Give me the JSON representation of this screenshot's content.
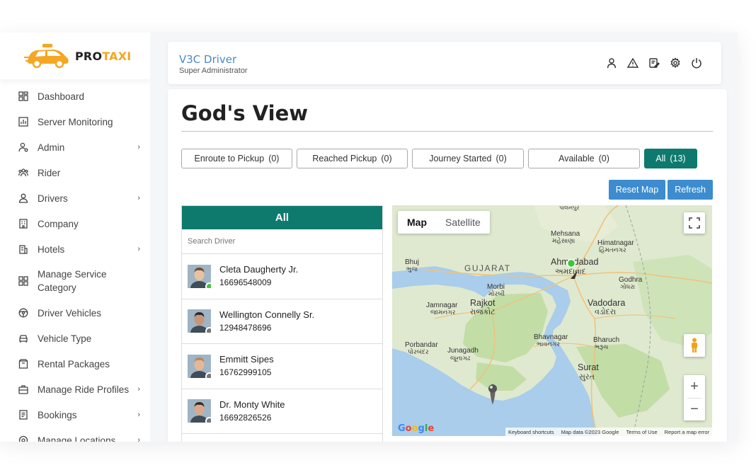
{
  "brand": {
    "pro": "PRO",
    "taxi": "TAXI"
  },
  "sidebar": {
    "items": [
      {
        "label": "Dashboard",
        "icon": "dashboard-icon",
        "has_sub": false
      },
      {
        "label": "Server Monitoring",
        "icon": "chart-icon",
        "has_sub": false
      },
      {
        "label": "Admin",
        "icon": "user-gear-icon",
        "has_sub": true
      },
      {
        "label": "Rider",
        "icon": "users-icon",
        "has_sub": false
      },
      {
        "label": "Drivers",
        "icon": "driver-icon",
        "has_sub": true
      },
      {
        "label": "Company",
        "icon": "building-icon",
        "has_sub": false
      },
      {
        "label": "Hotels",
        "icon": "hotel-icon",
        "has_sub": true
      },
      {
        "label": "Manage Service Category",
        "icon": "grid-icon",
        "has_sub": false
      },
      {
        "label": "Driver Vehicles",
        "icon": "steering-wheel-icon",
        "has_sub": false
      },
      {
        "label": "Vehicle Type",
        "icon": "car-icon",
        "has_sub": false
      },
      {
        "label": "Rental Packages",
        "icon": "package-icon",
        "has_sub": false
      },
      {
        "label": "Manage Ride Profiles",
        "icon": "briefcase-icon",
        "has_sub": true
      },
      {
        "label": "Bookings",
        "icon": "booking-icon",
        "has_sub": true
      },
      {
        "label": "Manage Locations",
        "icon": "location-icon",
        "has_sub": true
      }
    ]
  },
  "header": {
    "title": "V3C Driver",
    "subtitle": "Super Administrator"
  },
  "page": {
    "title": "God's View"
  },
  "filters": [
    {
      "label": "Enroute to Pickup",
      "count": "(0)",
      "active": false
    },
    {
      "label": "Reached Pickup",
      "count": "(0)",
      "active": false
    },
    {
      "label": "Journey Started",
      "count": "(0)",
      "active": false
    },
    {
      "label": "Available",
      "count": "(0)",
      "active": false
    },
    {
      "label": "All",
      "count": "(13)",
      "active": true
    }
  ],
  "actions": {
    "reset": "Reset Map",
    "refresh": "Refresh"
  },
  "driver_list": {
    "heading": "All",
    "search_placeholder": "Search Driver",
    "drivers": [
      {
        "name": "Cleta Daugherty Jr.",
        "phone": "16696548009",
        "status_color": "#3fc43f"
      },
      {
        "name": "Wellington Connelly Sr.",
        "phone": "12948478696",
        "status_color": "#777777"
      },
      {
        "name": "Emmitt Sipes",
        "phone": "16762999105",
        "status_color": "#777777"
      },
      {
        "name": "Dr. Monty White",
        "phone": "16692826526",
        "status_color": "#777777"
      }
    ]
  },
  "map": {
    "type_map": "Map",
    "type_satellite": "Satellite",
    "labels": {
      "gujarat": "GUJARAT",
      "ahmedabad": "Ahmedabad",
      "ahmedabad_local": "અમદાવાદ",
      "vadodara": "Vadodara",
      "vadodara_local": "વડોદરા",
      "rajkot": "Rajkot",
      "rajkot_local": "રાજકોટ",
      "bhavnagar": "Bhavnagar",
      "bhavnagar_local": "ભાવનગર",
      "surat": "Surat",
      "surat_local": "સુરત",
      "jamnagar": "Jamnagar",
      "jamnagar_local": "જામનગર",
      "junagadh": "Junagadh",
      "junagadh_local": "જૂનાગઢ",
      "porbandar": "Porbandar",
      "porbandar_local": "પોરબંદર",
      "bhuj": "Bhuj",
      "bhuj_local": "ભુજ",
      "morbi": "Morbi",
      "morbi_local": "મોરબી",
      "mehsana": "Mehsana",
      "mehsana_local": "મહેસાણા",
      "himatnagar": "Himatnagar",
      "himatnagar_local": "હિંમતનગર",
      "bharuch": "Bharuch",
      "bharuch_local": "ભરૂચ",
      "godhra": "Godhra",
      "godhra_local": "ગોધરા",
      "palanpur_local": "પાલનપુર"
    },
    "google": "Google",
    "footer": {
      "shortcuts": "Keyboard shortcuts",
      "data": "Map data ©2023 Google",
      "terms": "Terms of Use",
      "report": "Report a map error"
    },
    "colors": {
      "water": "#a9cdea",
      "land": "#dfe9cf",
      "green": "#c2dda6"
    }
  }
}
